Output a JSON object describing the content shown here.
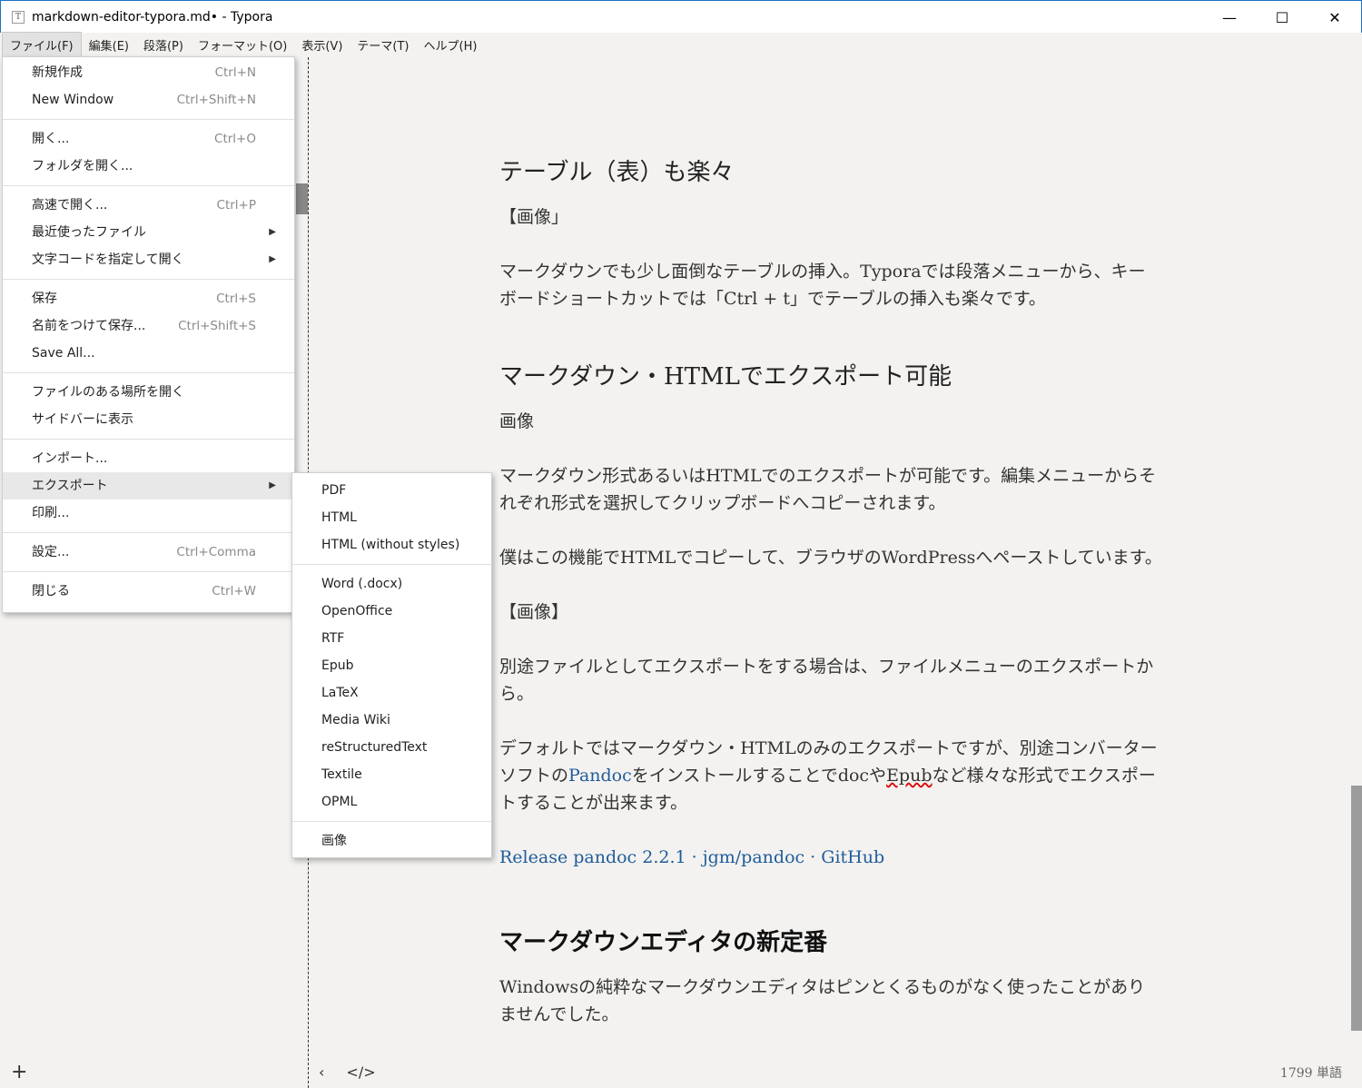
{
  "window": {
    "title": "markdown-editor-typora.md• - Typora",
    "app_icon": "T",
    "controls": {
      "minimize": "—",
      "maximize": "☐",
      "close": "✕"
    }
  },
  "menubar": [
    "ファイル(F)",
    "編集(E)",
    "段落(P)",
    "フォーマット(O)",
    "表示(V)",
    "テーマ(T)",
    "ヘルプ(H)"
  ],
  "file_menu": {
    "new": {
      "label": "新規作成",
      "shortcut": "Ctrl+N"
    },
    "new_window": {
      "label": "New Window",
      "shortcut": "Ctrl+Shift+N"
    },
    "open": {
      "label": "開く...",
      "shortcut": "Ctrl+O"
    },
    "open_folder": {
      "label": "フォルダを開く..."
    },
    "quick_open": {
      "label": "高速で開く...",
      "shortcut": "Ctrl+P"
    },
    "recent": {
      "label": "最近使ったファイル"
    },
    "reopen_encoding": {
      "label": "文字コードを指定して開く"
    },
    "save": {
      "label": "保存",
      "shortcut": "Ctrl+S"
    },
    "save_as": {
      "label": "名前をつけて保存...",
      "shortcut": "Ctrl+Shift+S"
    },
    "save_all": {
      "label": "Save All..."
    },
    "open_location": {
      "label": "ファイルのある場所を開く"
    },
    "reveal_sidebar": {
      "label": "サイドバーに表示"
    },
    "import": {
      "label": "インポート..."
    },
    "export": {
      "label": "エクスポート"
    },
    "print": {
      "label": "印刷..."
    },
    "preferences": {
      "label": "設定...",
      "shortcut": "Ctrl+Comma"
    },
    "close": {
      "label": "閉じる",
      "shortcut": "Ctrl+W"
    }
  },
  "export_menu": {
    "pdf": "PDF",
    "html": "HTML",
    "html_plain": "HTML (without styles)",
    "word": "Word (.docx)",
    "openoffice": "OpenOffice",
    "rtf": "RTF",
    "epub": "Epub",
    "latex": "LaTeX",
    "mediawiki": "Media Wiki",
    "rst": "reStructuredText",
    "textile": "Textile",
    "opml": "OPML",
    "image": "画像"
  },
  "document": {
    "h_table": "テーブル（表）も楽々",
    "img1": "【画像」",
    "p_table": "マークダウンでも少し面倒なテーブルの挿入。Typoraでは段落メニューから、キーボードショートカットでは「Ctrl + t」でテーブルの挿入も楽々です。",
    "h_export": "マークダウン・HTMLでエクスポート可能",
    "img2": "画像",
    "p_export1": "マークダウン形式あるいはHTMLでのエクスポートが可能です。編集メニューからそれぞれ形式を選択してクリップボードへコピーされます。",
    "p_export2": "僕はこの機能でHTMLでコピーして、ブラウザのWordPressへペーストしています。",
    "img3": "【画像】",
    "p_export3": "別途ファイルとしてエクスポートをする場合は、ファイルメニューのエクスポートから。",
    "p_pandoc_a": "デフォルトではマークダウン・HTMLのみのエクスポートですが、別途コンバーターソフトの",
    "p_pandoc_link": "Pandoc",
    "p_pandoc_b": "をインストールすることでdocや",
    "p_pandoc_spell": "Epub",
    "p_pandoc_c": "など様々な形式でエクスポートすることが出来ます。",
    "release_link": "Release pandoc 2.2.1 · jgm/pandoc · GitHub",
    "h_editor": "マークダウンエディタの新定番",
    "p_windows": "Windowsの純粋なマークダウンエディタはピンとくるものがなく使ったことがありませんでした。"
  },
  "footer": {
    "add": "+",
    "back": "‹",
    "source": "</>",
    "word_count": "1799 単語"
  }
}
